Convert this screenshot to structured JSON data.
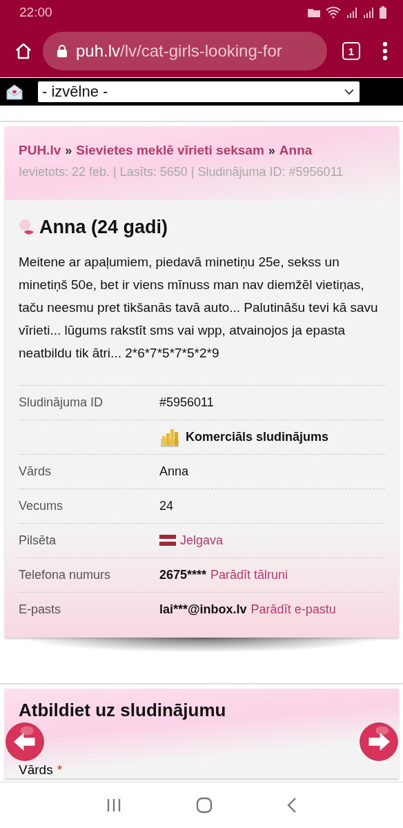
{
  "status_bar": {
    "time": "22:00"
  },
  "browser": {
    "url_host": "puh.lv",
    "url_path": "/lv/cat-girls-looking-for",
    "tab_count": "1"
  },
  "site_menu": {
    "value": "- izvēlne -"
  },
  "breadcrumb_separator": "»",
  "breadcrumb": [
    {
      "text": "PUH.lv"
    },
    {
      "text": "Sievietes meklē vīrieti seksam"
    },
    {
      "text": "Anna"
    }
  ],
  "meta": "Ievietots: 22 feb. | Lasīts: 5650 | Sludinājuma ID: #5956011",
  "ad": {
    "title": "Anna (24 gadi)",
    "description": "Meitene ar apaļumiem, piedavā minetiņu 25e, sekss un minetiņš 50e, bet ir viens mīnuss man nav diemžēl vietiņas, taču neesmu pret tikšanās tavā auto... Palutināšu tevi kā savu vīrieti... lūgums rakstīt sms vai wpp, atvainojos ja epasta neatbildu tik ātri... 2*6*7*5*7*5*2*9"
  },
  "details": [
    {
      "kind": "text",
      "label": "Sludinājuma ID",
      "value": "#5956011"
    },
    {
      "kind": "commercial",
      "value": "Komerciāls sludinājums"
    },
    {
      "kind": "text",
      "label": "Vārds",
      "value": "Anna"
    },
    {
      "kind": "text",
      "label": "Vecums",
      "value": "24"
    },
    {
      "kind": "city",
      "label": "Pilsēta",
      "value": "Jelgava"
    },
    {
      "kind": "contact",
      "label": "Telefona numurs",
      "value": "2675****",
      "link": "Parādīt tālruni"
    },
    {
      "kind": "contact",
      "label": "E-pasts",
      "value": "lai***@inbox.lv",
      "link": "Parādīt e-pastu"
    }
  ],
  "reply": {
    "title": "Atbildiet uz sludinājumu",
    "fields": [
      {
        "label": "Vārds",
        "required_mark": "*"
      }
    ]
  }
}
